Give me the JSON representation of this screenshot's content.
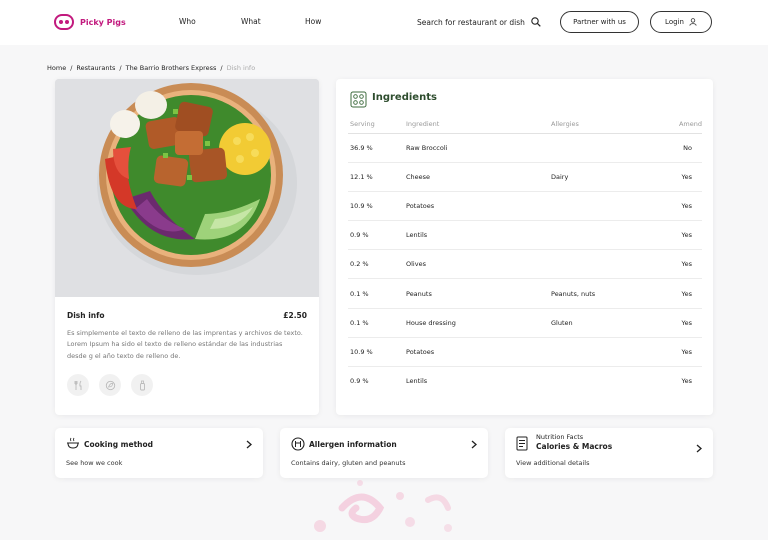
{
  "brand": {
    "name": "Picky Pigs",
    "color": "#c21a7e"
  },
  "nav": {
    "who": "Who",
    "what": "What",
    "how": "How"
  },
  "search": {
    "label": "Search for restaurant or dish",
    "icon": "search-icon"
  },
  "buttons": {
    "partner": "Partner with us",
    "login": "Login"
  },
  "breadcrumb": [
    "Home",
    "/",
    "Restaurants",
    "/",
    "The Barrio Brothers Express",
    "/",
    "Dish info"
  ],
  "dish": {
    "title": "Dish info",
    "price": "£2.50",
    "description": "Es simplemente el texto de relleno de las imprentas y archivos de texto. Lorem Ipsum ha sido el texto de relleno estándar de las industrias desde g el año texto de relleno de.",
    "icons": [
      "fork-knife-icon",
      "leaf-icon",
      "bottle-icon"
    ]
  },
  "ingredients": {
    "title": "Ingredients",
    "headers": {
      "serving": "Serving",
      "ingredient": "Ingredient",
      "allergies": "Allergies",
      "amend": "Amend"
    },
    "rows": [
      {
        "serving": "36.9 %",
        "ingredient": "Raw Broccoli",
        "allergies": "",
        "amend": "No"
      },
      {
        "serving": "12.1 %",
        "ingredient": "Cheese",
        "allergies": "Dairy",
        "amend": "Yes"
      },
      {
        "serving": "10.9 %",
        "ingredient": "Potatoes",
        "allergies": "",
        "amend": "Yes"
      },
      {
        "serving": "0.9 %",
        "ingredient": "Lentils",
        "allergies": "",
        "amend": "Yes"
      },
      {
        "serving": "0.2 %",
        "ingredient": "Olives",
        "allergies": "",
        "amend": "Yes"
      },
      {
        "serving": "0.1 %",
        "ingredient": "Peanuts",
        "allergies": "Peanuts, nuts",
        "amend": "Yes"
      },
      {
        "serving": "0.1 %",
        "ingredient": "House dressing",
        "allergies": "Gluten",
        "amend": "Yes"
      },
      {
        "serving": "10.9 %",
        "ingredient": "Potatoes",
        "allergies": "",
        "amend": "Yes"
      },
      {
        "serving": "0.9 %",
        "ingredient": "Lentils",
        "allergies": "",
        "amend": "Yes"
      }
    ]
  },
  "cards": {
    "cooking": {
      "title": "Cooking method",
      "sub": "See how we cook"
    },
    "allergen": {
      "title": "Allergen information",
      "sub": "Contains dairy, gluten and peanuts"
    },
    "nutrition": {
      "kicker": "Nutrition Facts",
      "title": "Calories & Macros",
      "sub": "View additional details"
    }
  }
}
